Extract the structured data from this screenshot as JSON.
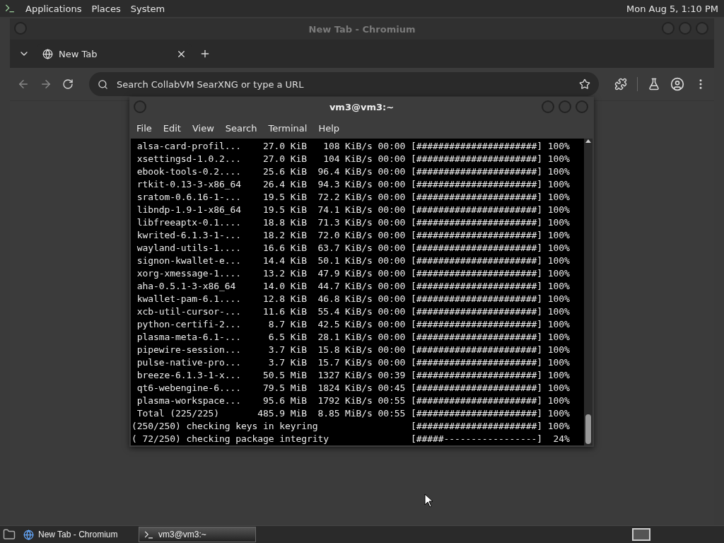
{
  "top_panel": {
    "menus": [
      "Applications",
      "Places",
      "System"
    ],
    "clock": "Mon Aug  5, 1:10 PM"
  },
  "browser": {
    "title": "New Tab - Chromium",
    "tabs": [
      {
        "label": "New Tab",
        "selected": true
      }
    ],
    "omnibox": {
      "placeholder": "Search CollabVM SearXNG or type a URL"
    }
  },
  "terminal": {
    "title": "vm3@vm3:~",
    "menu": [
      "File",
      "Edit",
      "View",
      "Search",
      "Terminal",
      "Help"
    ],
    "lines": [
      " alsa-card-profil...    27.0 KiB   108 KiB/s 00:00 [######################] 100%",
      " xsettingsd-1.0.2...    27.0 KiB   104 KiB/s 00:00 [######################] 100%",
      " ebook-tools-0.2....    25.6 KiB  96.4 KiB/s 00:00 [######################] 100%",
      " rtkit-0.13-3-x86_64    26.4 KiB  94.3 KiB/s 00:00 [######################] 100%",
      " sratom-0.6.16-1-...    19.5 KiB  72.2 KiB/s 00:00 [######################] 100%",
      " libndp-1.9-1-x86_64    19.5 KiB  74.1 KiB/s 00:00 [######################] 100%",
      " libfreeaptx-0.1....    18.8 KiB  71.3 KiB/s 00:00 [######################] 100%",
      " kwrited-6.1.3-1-...    18.2 KiB  72.0 KiB/s 00:00 [######################] 100%",
      " wayland-utils-1....    16.6 KiB  63.7 KiB/s 00:00 [######################] 100%",
      " signon-kwallet-e...    14.4 KiB  50.1 KiB/s 00:00 [######################] 100%",
      " xorg-xmessage-1....    13.2 KiB  47.9 KiB/s 00:00 [######################] 100%",
      " aha-0.5.1-3-x86_64     14.0 KiB  44.7 KiB/s 00:00 [######################] 100%",
      " kwallet-pam-6.1....    12.8 KiB  46.8 KiB/s 00:00 [######################] 100%",
      " xcb-util-cursor-...    11.6 KiB  55.4 KiB/s 00:00 [######################] 100%",
      " python-certifi-2...     8.7 KiB  42.5 KiB/s 00:00 [######################] 100%",
      " plasma-meta-6.1-...     6.5 KiB  28.1 KiB/s 00:00 [######################] 100%",
      " pipewire-session...     3.7 KiB  15.8 KiB/s 00:00 [######################] 100%",
      " pulse-native-pro...     3.7 KiB  15.7 KiB/s 00:00 [######################] 100%",
      " breeze-6.1.3-1-x...    50.5 MiB  1327 KiB/s 00:39 [######################] 100%",
      " qt6-webengine-6....    79.5 MiB  1824 KiB/s 00:45 [######################] 100%",
      " plasma-workspace...    95.6 MiB  1792 KiB/s 00:55 [######################] 100%",
      " Total (225/225)       485.9 MiB  8.85 MiB/s 00:55 [######################] 100%",
      "(250/250) checking keys in keyring                 [######################] 100%",
      "( 72/250) checking package integrity               [#####-----------------]  24%"
    ]
  },
  "taskbar": {
    "items": [
      {
        "label": "New Tab - Chromium",
        "kind": "browser",
        "selected": false
      },
      {
        "label": "vm3@vm3:~",
        "kind": "terminal",
        "selected": true
      }
    ]
  }
}
